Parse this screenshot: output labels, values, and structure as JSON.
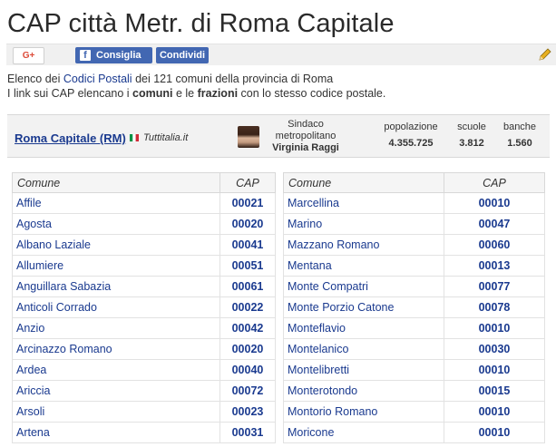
{
  "title": "CAP città Metr. di Roma Capitale",
  "share": {
    "gplus": "G+",
    "fb_like": "Consiglia",
    "fb_share": "Condividi"
  },
  "intro": {
    "l1a": "Elenco dei ",
    "l1link": "Codici Postali",
    "l1b": " dei 121 comuni della provincia di Roma",
    "l2a": "I link sui CAP elencano i ",
    "l2b1": "comuni",
    "l2mid": " e le ",
    "l2b2": "frazioni",
    "l2c": " con lo stesso codice postale."
  },
  "info": {
    "city": "Roma Capitale (RM)",
    "source": "Tuttitalia.it",
    "sindaco_l1": "Sindaco",
    "sindaco_l2": "metropolitano",
    "sindaco_name": "Virginia Raggi",
    "pop_label": "popolazione",
    "pop_value": "4.355.725",
    "scuole_label": "scuole",
    "scuole_value": "3.812",
    "banche_label": "banche",
    "banche_value": "1.560"
  },
  "table_headers": {
    "comune": "Comune",
    "cap": "CAP"
  },
  "left_rows": [
    [
      "Affile",
      "00021"
    ],
    [
      "Agosta",
      "00020"
    ],
    [
      "Albano Laziale",
      "00041"
    ],
    [
      "Allumiere",
      "00051"
    ],
    [
      "Anguillara Sabazia",
      "00061"
    ],
    [
      "Anticoli Corrado",
      "00022"
    ],
    [
      "Anzio",
      "00042"
    ],
    [
      "Arcinazzo Romano",
      "00020"
    ],
    [
      "Ardea",
      "00040"
    ],
    [
      "Ariccia",
      "00072"
    ],
    [
      "Arsoli",
      "00023"
    ],
    [
      "Artena",
      "00031"
    ]
  ],
  "right_rows": [
    [
      "Marcellina",
      "00010"
    ],
    [
      "Marino",
      "00047"
    ],
    [
      "Mazzano Romano",
      "00060"
    ],
    [
      "Mentana",
      "00013"
    ],
    [
      "Monte Compatri",
      "00077"
    ],
    [
      "Monte Porzio Catone",
      "00078"
    ],
    [
      "Monteflavio",
      "00010"
    ],
    [
      "Montelanico",
      "00030"
    ],
    [
      "Montelibretti",
      "00010"
    ],
    [
      "Monterotondo",
      "00015"
    ],
    [
      "Montorio Romano",
      "00010"
    ],
    [
      "Moricone",
      "00010"
    ]
  ]
}
